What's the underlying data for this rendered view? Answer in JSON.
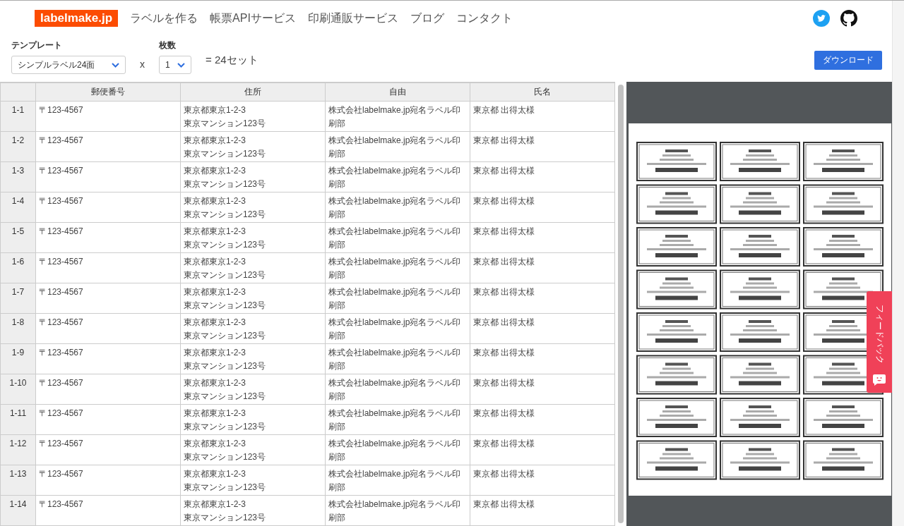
{
  "nav": {
    "logo": "labelmake.jp",
    "links": [
      "ラベルを作る",
      "帳票APIサービス",
      "印刷通販サービス",
      "ブログ",
      "コンタクト"
    ]
  },
  "controls": {
    "template_label": "テンプレート",
    "template_value": "シンプルラベル24面",
    "times": "x",
    "count_label": "枚数",
    "count_value": "1",
    "result": "= 24セット",
    "download": "ダウンロード"
  },
  "table": {
    "columns": [
      "郵便番号",
      "住所",
      "自由",
      "氏名"
    ],
    "rows": [
      {
        "id": "1-1",
        "postal": "〒123-4567",
        "address": [
          "東京都東京1-2-3",
          "東京マンション123号"
        ],
        "free": "株式会社labelmake.jp宛名ラベル印刷部",
        "name": "東京都 出得太様"
      },
      {
        "id": "1-2",
        "postal": "〒123-4567",
        "address": [
          "東京都東京1-2-3",
          "東京マンション123号"
        ],
        "free": "株式会社labelmake.jp宛名ラベル印刷部",
        "name": "東京都 出得太様"
      },
      {
        "id": "1-3",
        "postal": "〒123-4567",
        "address": [
          "東京都東京1-2-3",
          "東京マンション123号"
        ],
        "free": "株式会社labelmake.jp宛名ラベル印刷部",
        "name": "東京都 出得太様"
      },
      {
        "id": "1-4",
        "postal": "〒123-4567",
        "address": [
          "東京都東京1-2-3",
          "東京マンション123号"
        ],
        "free": "株式会社labelmake.jp宛名ラベル印刷部",
        "name": "東京都 出得太様"
      },
      {
        "id": "1-5",
        "postal": "〒123-4567",
        "address": [
          "東京都東京1-2-3",
          "東京マンション123号"
        ],
        "free": "株式会社labelmake.jp宛名ラベル印刷部",
        "name": "東京都 出得太様"
      },
      {
        "id": "1-6",
        "postal": "〒123-4567",
        "address": [
          "東京都東京1-2-3",
          "東京マンション123号"
        ],
        "free": "株式会社labelmake.jp宛名ラベル印刷部",
        "name": "東京都 出得太様"
      },
      {
        "id": "1-7",
        "postal": "〒123-4567",
        "address": [
          "東京都東京1-2-3",
          "東京マンション123号"
        ],
        "free": "株式会社labelmake.jp宛名ラベル印刷部",
        "name": "東京都 出得太様"
      },
      {
        "id": "1-8",
        "postal": "〒123-4567",
        "address": [
          "東京都東京1-2-3",
          "東京マンション123号"
        ],
        "free": "株式会社labelmake.jp宛名ラベル印刷部",
        "name": "東京都 出得太様"
      },
      {
        "id": "1-9",
        "postal": "〒123-4567",
        "address": [
          "東京都東京1-2-3",
          "東京マンション123号"
        ],
        "free": "株式会社labelmake.jp宛名ラベル印刷部",
        "name": "東京都 出得太様"
      },
      {
        "id": "1-10",
        "postal": "〒123-4567",
        "address": [
          "東京都東京1-2-3",
          "東京マンション123号"
        ],
        "free": "株式会社labelmake.jp宛名ラベル印刷部",
        "name": "東京都 出得太様"
      },
      {
        "id": "1-11",
        "postal": "〒123-4567",
        "address": [
          "東京都東京1-2-3",
          "東京マンション123号"
        ],
        "free": "株式会社labelmake.jp宛名ラベル印刷部",
        "name": "東京都 出得太様"
      },
      {
        "id": "1-12",
        "postal": "〒123-4567",
        "address": [
          "東京都東京1-2-3",
          "東京マンション123号"
        ],
        "free": "株式会社labelmake.jp宛名ラベル印刷部",
        "name": "東京都 出得太様"
      },
      {
        "id": "1-13",
        "postal": "〒123-4567",
        "address": [
          "東京都東京1-2-3",
          "東京マンション123号"
        ],
        "free": "株式会社labelmake.jp宛名ラベル印刷部",
        "name": "東京都 出得太様"
      },
      {
        "id": "1-14",
        "postal": "〒123-4567",
        "address": [
          "東京都東京1-2-3",
          "東京マンション123号"
        ],
        "free": "株式会社labelmake.jp宛名ラベル印刷部",
        "name": "東京都 出得太様"
      }
    ]
  },
  "feedback": {
    "label": "フィードバック"
  }
}
